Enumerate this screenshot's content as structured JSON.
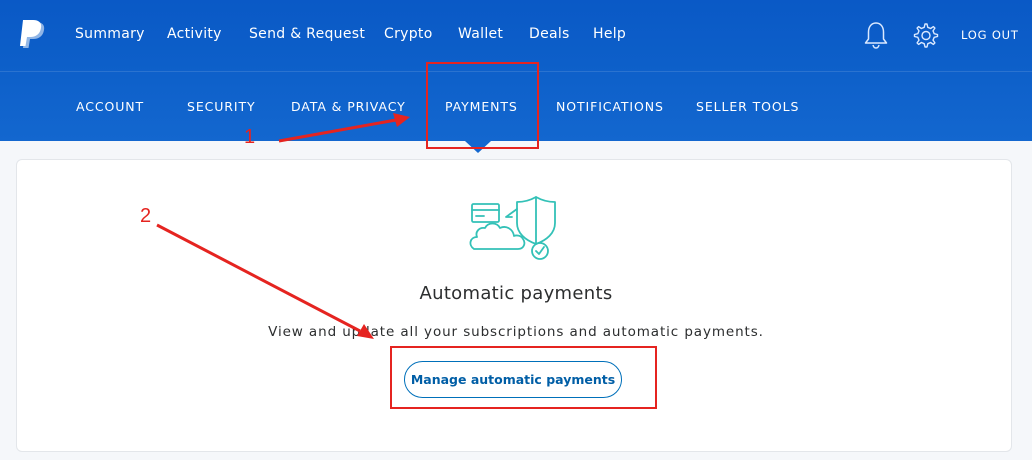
{
  "colors": {
    "header_blue": "#0d5fc9",
    "accent_teal": "#33c1b7",
    "button_blue": "#0070ba",
    "annotation_red": "#e52420"
  },
  "topnav": {
    "logo_icon": "paypal-logo",
    "items": [
      "Summary",
      "Activity",
      "Send & Request",
      "Crypto",
      "Wallet",
      "Deals",
      "Help"
    ],
    "notification_icon": "bell-icon",
    "settings_icon": "gear-icon",
    "logout_label": "LOG OUT"
  },
  "subnav": {
    "items": [
      "ACCOUNT",
      "SECURITY",
      "DATA & PRIVACY",
      "PAYMENTS",
      "NOTIFICATIONS",
      "SELLER TOOLS"
    ],
    "active": "PAYMENTS"
  },
  "card": {
    "illustration_icon": "payments-shield-cloud-icon",
    "title": "Automatic payments",
    "description": "View and update all your subscriptions and automatic payments.",
    "button_label": "Manage automatic payments"
  },
  "annotations": {
    "step1": "1",
    "step2": "2"
  }
}
